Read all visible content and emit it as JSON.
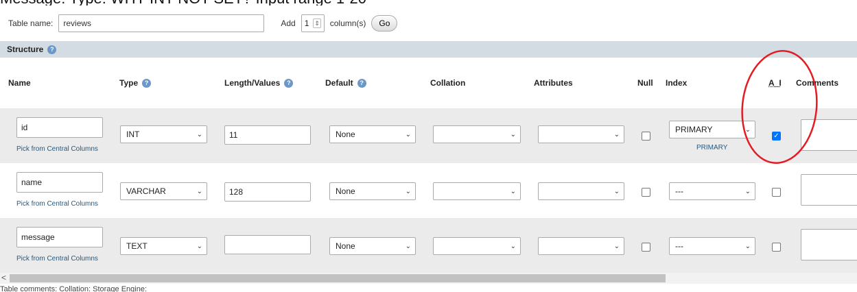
{
  "top_cut_text": "Message: Type: WHY INT NOT SET? Input range 1-20",
  "topbar": {
    "table_name_label": "Table name:",
    "table_name_value": "reviews",
    "add_label": "Add",
    "add_count": "1",
    "columns_label": "column(s)",
    "go_label": "Go"
  },
  "structure": {
    "title": "Structure",
    "help_glyph": "?"
  },
  "headers": {
    "name": "Name",
    "type": "Type",
    "length": "Length/Values",
    "default": "Default",
    "collation": "Collation",
    "attributes": "Attributes",
    "null": "Null",
    "index": "Index",
    "ai": "A_I",
    "comments": "Comments"
  },
  "rows": [
    {
      "name": "id",
      "pick": "Pick from Central Columns",
      "type": "INT",
      "length": "11",
      "default": "None",
      "collation": "",
      "attributes": "",
      "null": false,
      "index": "PRIMARY",
      "index_sub": "PRIMARY",
      "ai": true
    },
    {
      "name": "name",
      "pick": "Pick from Central Columns",
      "type": "VARCHAR",
      "length": "128",
      "default": "None",
      "collation": "",
      "attributes": "",
      "null": false,
      "index": "---",
      "index_sub": "",
      "ai": false
    },
    {
      "name": "message",
      "pick": "Pick from Central Columns",
      "type": "TEXT",
      "length": "",
      "default": "None",
      "collation": "",
      "attributes": "",
      "null": false,
      "index": "---",
      "index_sub": "",
      "ai": false
    }
  ],
  "colors": {
    "structure_bar": "#d3dce3",
    "row_even": "#ebebeb",
    "link": "#235a81",
    "annotation": "#e31b23",
    "checkbox": "#0075ff"
  },
  "scrollbar": {
    "left_arrow": "<"
  },
  "bottom_cut_text": "Table comments: Collation: Storage Engine:"
}
